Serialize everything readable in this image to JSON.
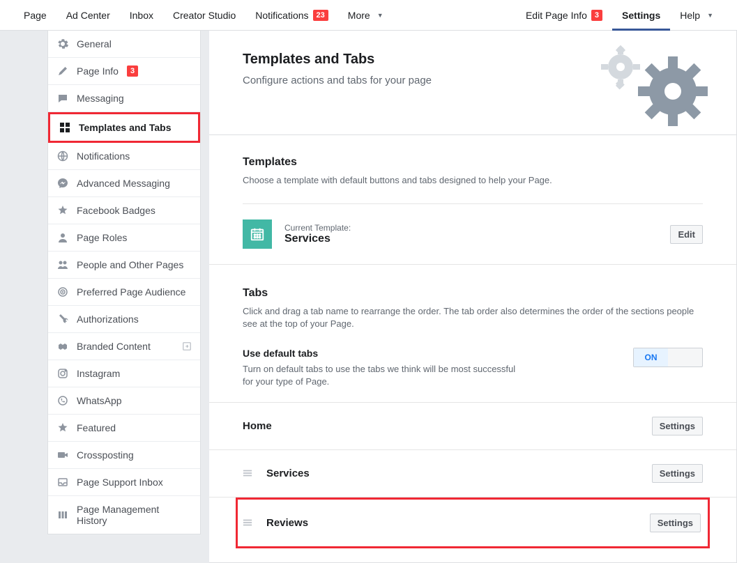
{
  "topnav": {
    "left": [
      {
        "label": "Page"
      },
      {
        "label": "Ad Center"
      },
      {
        "label": "Inbox"
      },
      {
        "label": "Creator Studio"
      },
      {
        "label": "Notifications",
        "badge": "23"
      },
      {
        "label": "More",
        "dropdown": true
      }
    ],
    "right": [
      {
        "label": "Edit Page Info",
        "badge": "3"
      },
      {
        "label": "Settings",
        "active": true
      },
      {
        "label": "Help",
        "dropdown": true
      }
    ]
  },
  "sidebar": [
    {
      "label": "General",
      "icon": "gear"
    },
    {
      "label": "Page Info",
      "icon": "pencil",
      "badge": "3"
    },
    {
      "label": "Messaging",
      "icon": "chat"
    },
    {
      "label": "Templates and Tabs",
      "icon": "grid",
      "active": true
    },
    {
      "label": "Notifications",
      "icon": "globe"
    },
    {
      "label": "Advanced Messaging",
      "icon": "messenger"
    },
    {
      "label": "Facebook Badges",
      "icon": "star"
    },
    {
      "label": "Page Roles",
      "icon": "person"
    },
    {
      "label": "People and Other Pages",
      "icon": "people"
    },
    {
      "label": "Preferred Page Audience",
      "icon": "target"
    },
    {
      "label": "Authorizations",
      "icon": "wrench"
    },
    {
      "label": "Branded Content",
      "icon": "handshake",
      "trail": true
    },
    {
      "label": "Instagram",
      "icon": "instagram"
    },
    {
      "label": "WhatsApp",
      "icon": "whatsapp"
    },
    {
      "label": "Featured",
      "icon": "star2"
    },
    {
      "label": "Crossposting",
      "icon": "camera"
    },
    {
      "label": "Page Support Inbox",
      "icon": "inbox"
    },
    {
      "label": "Page Management History",
      "icon": "history"
    }
  ],
  "hero": {
    "title": "Templates and Tabs",
    "subtitle": "Configure actions and tabs for your page"
  },
  "templates": {
    "heading": "Templates",
    "desc": "Choose a template with default buttons and tabs designed to help your Page.",
    "current_label": "Current Template:",
    "current_name": "Services",
    "edit_label": "Edit"
  },
  "tabs_section": {
    "heading": "Tabs",
    "desc": "Click and drag a tab name to rearrange the order. The tab order also determines the order of the sections people see at the top of your Page."
  },
  "default_tabs": {
    "heading": "Use default tabs",
    "desc": "Turn on default tabs to use the tabs we think will be most successful for your type of Page.",
    "toggle_state": "ON"
  },
  "tab_list": {
    "settings_label": "Settings",
    "items": [
      {
        "name": "Home",
        "drag": false
      },
      {
        "name": "Services",
        "drag": true
      },
      {
        "name": "Reviews",
        "drag": true,
        "highlight": true
      }
    ]
  }
}
